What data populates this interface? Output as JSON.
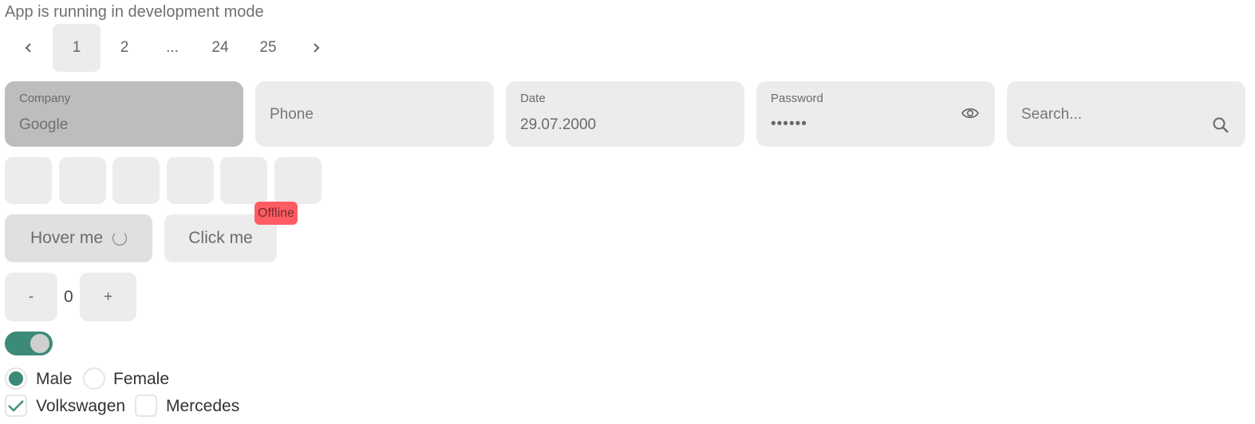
{
  "banner": "App is running in development mode",
  "pagination": {
    "prev_icon": "chevron-left-icon",
    "next_icon": "chevron-right-icon",
    "pages": [
      "1",
      "2",
      "...",
      "24",
      "25"
    ],
    "active": "1"
  },
  "fields": {
    "company": {
      "label": "Company",
      "value": "Google",
      "disabled": true
    },
    "phone": {
      "placeholder": "Phone"
    },
    "date": {
      "label": "Date",
      "value": "29.07.2000"
    },
    "password": {
      "label": "Password",
      "value": "••••••",
      "icon": "eye-icon"
    },
    "search": {
      "placeholder": "Search...",
      "icon": "search-icon"
    }
  },
  "buttons": {
    "hover": "Hover me",
    "click": "Click me",
    "badge": "Offline"
  },
  "stepper": {
    "minus": "-",
    "value": "0",
    "plus": "+"
  },
  "toggle": {
    "on": true
  },
  "gender": {
    "options": [
      "Male",
      "Female"
    ],
    "selected": "Male"
  },
  "cars": {
    "options": [
      "Volkswagen",
      "Mercedes"
    ],
    "checked": [
      "Volkswagen"
    ]
  },
  "colors": {
    "accent": "#3c8a78",
    "badge": "#ff5c63",
    "field_bg": "#ececec",
    "disabled_bg": "#bdbdbd"
  }
}
